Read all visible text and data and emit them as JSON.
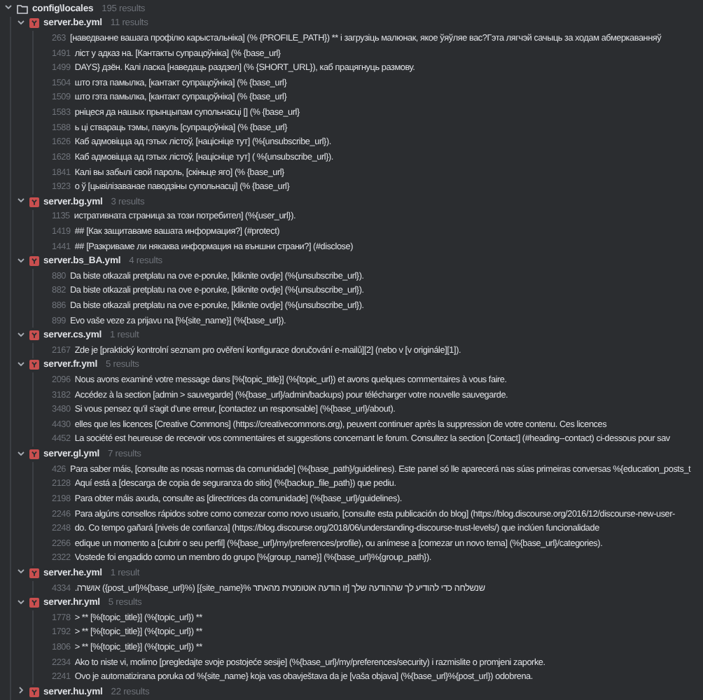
{
  "folder": {
    "name": "config\\locales",
    "count": "195 results",
    "expanded": true
  },
  "files": [
    {
      "name": "server.be.yml",
      "count": "11 results",
      "expanded": true,
      "matches": [
        {
          "line": "263",
          "text": "[наведванне вашага профілю карыстальніка] (% {PROFILE_PATH}) ** і загрузіць малюнак, якое ўяўляе вас?Гэта лягчэй сачыць за ходам абмеркаванняў"
        },
        {
          "line": "1491",
          "text": "ліст у адказ на. [Кантакты супрацоўніка] (% {base_url}"
        },
        {
          "line": "1499",
          "text": "DAYS} дзён. Калі ласка [наведаць раздзел] (% {SHORT_URL}), каб працягнуць размову."
        },
        {
          "line": "1504",
          "text": " што гэта памылка, [кантакт супрацоўніка] (% {base_url}"
        },
        {
          "line": "1509",
          "text": " што гэта памылка, [кантакт супрацоўніка] (% {base_url}"
        },
        {
          "line": "1583",
          "text": "рніцеся да нашых прынцыпам супольнасці [] (% {base_url}"
        },
        {
          "line": "1588",
          "text": "ь ці ствараць тэмы, пакуль [супрацоўніка] (% {base_url}"
        },
        {
          "line": "1626",
          "text": "Каб адмовіцца ад гэтых лістоў, [націсніце тут] (%{unsubscribe_url})."
        },
        {
          "line": "1628",
          "text": "Каб адмовіцца ад гэтых лістоў, [націсніце тут] ( %{unsubscribe_url})."
        },
        {
          "line": "1841",
          "text": "Калі вы забылі свой пароль, [скіньце яго] (% {base_url}"
        },
        {
          "line": "1923",
          "text": "о ў [цывілізаванае паводзіны супольнасці] (% {base_url}"
        }
      ]
    },
    {
      "name": "server.bg.yml",
      "count": "3 results",
      "expanded": true,
      "matches": [
        {
          "line": "1135",
          "text": "истративната страница за този потребител] (%{user_url})."
        },
        {
          "line": "1419",
          "text": "## [Как защитаваме вашата информация?] (#protect)"
        },
        {
          "line": "1441",
          "text": "## [Разкриваме ли някаква информация на външни страни?] (#disclose)"
        }
      ]
    },
    {
      "name": "server.bs_BA.yml",
      "count": "4 results",
      "expanded": true,
      "matches": [
        {
          "line": "880",
          "text": "Da biste otkazali pretplatu na ove e-poruke, [kliknite ovdje] (%{unsubscribe_url})."
        },
        {
          "line": "882",
          "text": "Da biste otkazali pretplatu na ove e-poruke, [kliknite ovdje] (%{unsubscribe_url})."
        },
        {
          "line": "886",
          "text": "Da biste otkazali pretplatu na ove e-poruke, [kliknite ovdje] (%{unsubscribe_url})."
        },
        {
          "line": "899",
          "text": "Evo vaše veze za prijavu na [%{site_name}] (%{base_url})."
        }
      ]
    },
    {
      "name": "server.cs.yml",
      "count": "1 result",
      "expanded": true,
      "matches": [
        {
          "line": "2167",
          "text": "Zde je [praktický kontrolní seznam pro ověření konfigurace doručování e-mailů][2] (nebo v [v originále][1])."
        }
      ]
    },
    {
      "name": "server.fr.yml",
      "count": "5 results",
      "expanded": true,
      "matches": [
        {
          "line": "2096",
          "text": "Nous avons examiné votre message dans [%{topic_title}] (%{topic_url}) et avons quelques commentaires à vous faire."
        },
        {
          "line": "3182",
          "text": "Accédez à la section [admin > sauvegarde] (%{base_url}/admin/backups) pour télécharger votre nouvelle sauvegarde."
        },
        {
          "line": "3480",
          "text": "Si vous pensez qu'il s'agit d'une erreur, [contactez un responsable] (%{base_url}/about)."
        },
        {
          "line": "4430",
          "text": "elles que les licences [Creative Commons] (https://creativecommons.org), peuvent continuer après la suppression de votre contenu. Ces licences"
        },
        {
          "line": "4452",
          "text": "La société est heureuse de recevoir vos commentaires et suggestions concernant le forum. Consultez la section [Contact] (#heading--contact) ci-dessous pour sav"
        }
      ]
    },
    {
      "name": "server.gl.yml",
      "count": "7 results",
      "expanded": true,
      "matches": [
        {
          "line": "426",
          "text": "Para saber máis, [consulte as nosas normas da comunidade] (%{base_path}/guidelines). Este panel só lle aparecerá nas súas primeiras conversas %{education_posts_t"
        },
        {
          "line": "2128",
          "text": "Aquí está a [descarga de copia de seguranza do sitio] (%{backup_file_path}) que pediu."
        },
        {
          "line": "2198",
          "text": "Para obter máis axuda, consulte as [directrices da comunidade] (%{base_url}/guidelines)."
        },
        {
          "line": "2246",
          "text": "Para algúns consellos rápidos sobre como comezar como novo usuario, [consulte esta publicación do blog] (https://blog.discourse.org/2016/12/discourse-new-user-"
        },
        {
          "line": "2248",
          "text": "do. Co tempo gañará [niveis de confianza] (https://blog.discourse.org/2018/06/understanding-discourse-trust-levels/) que inclúen funcionalidade"
        },
        {
          "line": "2266",
          "text": "edique un momento a [cubrir o seu perfil] (%{base_url}/my/preferences/profile), ou anímese a [comezar un novo tema] (%{base_url}/categories)."
        },
        {
          "line": "2322",
          "text": "Vostede foi engadido como un membro do grupo [%{group_name}] (%{base_url}%{group_path})."
        }
      ]
    },
    {
      "name": "server.he.yml",
      "count": "1 result",
      "expanded": true,
      "matches": [
        {
          "line": "4334",
          "text": "שנשלחה כדי להודיע לך שההודעה שלך [זו הודעה אוטומטית מהאתר %{site_name}] (%{base_url}%{post_url}) אושרה."
        }
      ]
    },
    {
      "name": "server.hr.yml",
      "count": "5 results",
      "expanded": true,
      "matches": [
        {
          "line": "1778",
          "text": "> ** [%{topic_title}] (%{topic_url}) **"
        },
        {
          "line": "1792",
          "text": "> ** [%{topic_title}] (%{topic_url}) **"
        },
        {
          "line": "1806",
          "text": "> ** [%{topic_title}] (%{topic_url}) **"
        },
        {
          "line": "2234",
          "text": "Ako to niste vi, molimo [pregledajte svoje postojeće sesije] (%{base_url}/my/preferences/security) i razmislite o promjeni zaporke."
        },
        {
          "line": "2241",
          "text": "Ovo je automatizirana poruka od %{site_name} koja vas obavještava da je [vaša objava] (%{base_url}%{post_url}) odobrena."
        }
      ]
    },
    {
      "name": "server.hu.yml",
      "count": "22 results",
      "expanded": false
    }
  ]
}
